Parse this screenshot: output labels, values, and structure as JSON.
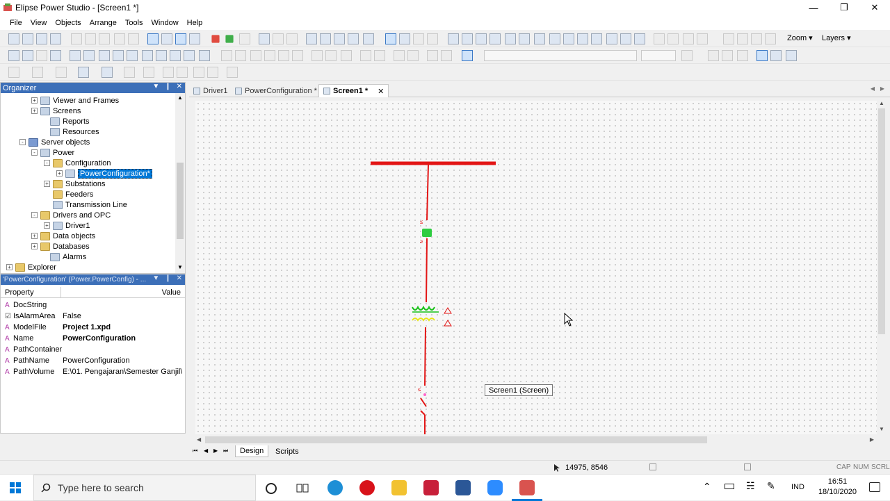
{
  "window": {
    "title": "Elipse Power Studio - [Screen1 *]",
    "controls": [
      "minimize-icon",
      "restore-icon",
      "close-icon"
    ]
  },
  "menu": [
    "File",
    "View",
    "Objects",
    "Arrange",
    "Tools",
    "Window",
    "Help"
  ],
  "toolbar": {
    "zoom_label": "Zoom",
    "layers_label": "Layers"
  },
  "organizer": {
    "title": "Organizer",
    "tree": [
      {
        "label": "Viewer and Frames",
        "icon": "viewer-icon",
        "expander": "+"
      },
      {
        "label": "Screens",
        "icon": "screens-icon",
        "expander": "+"
      },
      {
        "label": "Reports",
        "icon": "reports-icon",
        "expander": ""
      },
      {
        "label": "Resources",
        "icon": "resources-icon",
        "expander": ""
      },
      {
        "label": "Server objects",
        "icon": "server-objects-icon",
        "expander": "-"
      },
      {
        "label": "Power",
        "icon": "power-icon",
        "expander": "-"
      },
      {
        "label": "Configuration",
        "icon": "folder-icon",
        "expander": "-"
      },
      {
        "label": "PowerConfiguration*",
        "icon": "power-configuration-icon",
        "expander": "+",
        "selected": true
      },
      {
        "label": "Substations",
        "icon": "folder-icon",
        "expander": "+"
      },
      {
        "label": "Feeders",
        "icon": "folder-icon",
        "expander": ""
      },
      {
        "label": "Transmission Line",
        "icon": "transmission-line-icon",
        "expander": ""
      },
      {
        "label": "Drivers and OPC",
        "icon": "folder-icon",
        "expander": "-"
      },
      {
        "label": "Driver1",
        "icon": "driver-icon",
        "expander": "+"
      },
      {
        "label": "Data objects",
        "icon": "folder-icon",
        "expander": "+"
      },
      {
        "label": "Databases",
        "icon": "folder-icon",
        "expander": "+"
      },
      {
        "label": "Alarms",
        "icon": "alarms-icon",
        "expander": ""
      },
      {
        "label": "Explorer",
        "icon": "folder-icon",
        "expander": "+"
      }
    ]
  },
  "properties": {
    "title": "'PowerConfiguration' (Power.PowerConfig) - ...",
    "col_property": "Property",
    "col_value": "Value",
    "rows": [
      {
        "name": "DocString",
        "value": "",
        "bold": false,
        "type": "A"
      },
      {
        "name": "IsAlarmArea",
        "value": "False",
        "bold": false,
        "type": "☑"
      },
      {
        "name": "ModelFile",
        "value": "Project 1.xpd",
        "bold": true,
        "type": "A"
      },
      {
        "name": "Name",
        "value": "PowerConfiguration",
        "bold": true,
        "type": "A"
      },
      {
        "name": "PathContainer",
        "value": "",
        "bold": false,
        "type": "A"
      },
      {
        "name": "PathName",
        "value": "PowerConfiguration",
        "bold": false,
        "type": "A"
      },
      {
        "name": "PathVolume",
        "value": "E:\\01. Pengajaran\\Semester Ganjil\\...",
        "bold": false,
        "type": "A"
      }
    ]
  },
  "doc_tabs": [
    {
      "label": "Driver1",
      "active": false
    },
    {
      "label": "PowerConfiguration *",
      "active": false
    },
    {
      "label": "Screen1 *",
      "active": true
    }
  ],
  "canvas": {
    "tooltip": "Screen1 (Screen)"
  },
  "bottom_tabs": [
    {
      "label": "Design",
      "active": true
    },
    {
      "label": "Scripts",
      "active": false
    }
  ],
  "status": {
    "coords": "14975, 8546",
    "indicators": [
      "CAP",
      "NUM",
      "SCRL"
    ]
  },
  "taskbar": {
    "search_placeholder": "Type here to search",
    "language": "IND",
    "time": "16:51",
    "date": "18/10/2020"
  },
  "colors": {
    "bus": "#e31515",
    "breaker": "#2ecc40",
    "panel_header": "#3c6fb8",
    "selection": "#0078d7"
  }
}
